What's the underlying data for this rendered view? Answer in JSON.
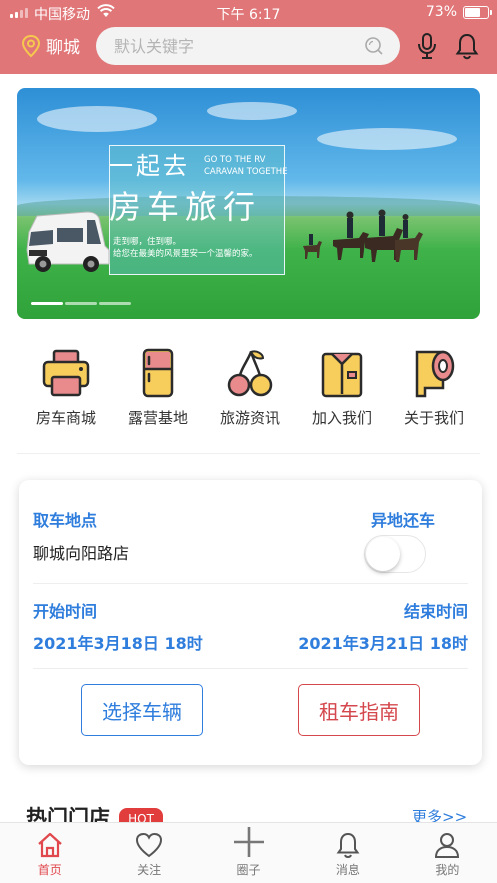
{
  "status_bar": {
    "carrier": "中国移动",
    "time": "下午 6:17",
    "battery": "73%",
    "battery_level": 0.73
  },
  "header": {
    "location": "聊城",
    "search_placeholder": "默认关键字"
  },
  "banner": {
    "title_line1": "一起去",
    "title_line2": "房车旅行",
    "english_line1": "GO TO THE RV",
    "english_line2": "CARAVAN TOGETHE",
    "subtitle_line1": "走到哪，住到哪。",
    "subtitle_line2": "给您在最美的风景里安一个温馨的家。",
    "slide_count": 3,
    "active_slide": 1
  },
  "categories": [
    {
      "label": "房车商城",
      "icon": "printer-icon"
    },
    {
      "label": "露营基地",
      "icon": "fridge-icon"
    },
    {
      "label": "旅游资讯",
      "icon": "cherry-icon"
    },
    {
      "label": "加入我们",
      "icon": "shirt-icon"
    },
    {
      "label": "关于我们",
      "icon": "paper-roll-icon"
    }
  ],
  "booking": {
    "pickup_label": "取车地点",
    "pickup_value": "聊城向阳路店",
    "return_label": "异地还车",
    "return_enabled": false,
    "start_label": "开始时间",
    "start_value": "2021年3月18日  18时",
    "end_label": "结束时间",
    "end_value": "2021年3月21日  18时",
    "select_vehicle": "选择车辆",
    "rental_guide": "租车指南"
  },
  "hot_stores": {
    "title": "热门门店",
    "badge": "HOT",
    "more": "更多>>"
  },
  "tabbar": [
    {
      "label": "首页",
      "icon": "home-icon",
      "active": true
    },
    {
      "label": "关注",
      "icon": "heart-icon",
      "active": false
    },
    {
      "label": "圈子",
      "icon": "plus-icon",
      "active": false
    },
    {
      "label": "消息",
      "icon": "bell-icon",
      "active": false
    },
    {
      "label": "我的",
      "icon": "user-icon",
      "active": false
    }
  ],
  "colors": {
    "header": "#e07678",
    "accent_blue": "#2f7ddc",
    "accent_red": "#d4474c",
    "tab_active": "#e0484d"
  }
}
